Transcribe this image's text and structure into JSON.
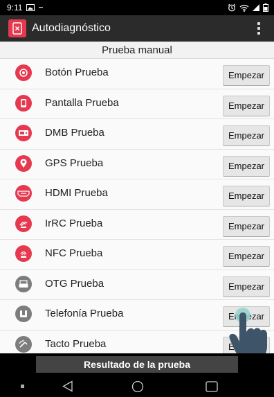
{
  "status_bar": {
    "time": "9:11"
  },
  "app_bar": {
    "title": "Autodiagnóstico"
  },
  "section": {
    "title": "Prueba manual"
  },
  "tests": [
    {
      "label": "Botón Prueba",
      "button": "Empezar",
      "icon": "button-icon"
    },
    {
      "label": "Pantalla Prueba",
      "button": "Empezar",
      "icon": "screen-icon"
    },
    {
      "label": "DMB Prueba",
      "button": "Empezar",
      "icon": "dmb-icon"
    },
    {
      "label": "GPS Prueba",
      "button": "Empezar",
      "icon": "gps-pin-icon"
    },
    {
      "label": "HDMI Prueba",
      "button": "Empezar",
      "icon": "hdmi-icon"
    },
    {
      "label": "IrRC Prueba",
      "button": "Empezar",
      "icon": "irrc-icon"
    },
    {
      "label": "NFC Prueba",
      "button": "Empezar",
      "icon": "nfc-icon"
    },
    {
      "label": "OTG Prueba",
      "button": "Empezar",
      "icon": "otg-icon"
    },
    {
      "label": "Telefonía Prueba",
      "button": "Empezar",
      "icon": "phone-icon"
    },
    {
      "label": "Tacto Prueba",
      "button": "Empezar",
      "icon": "touch-icon"
    }
  ],
  "result_button": "Resultado de la prueba",
  "colors": {
    "accent": "#e53950",
    "disabled_icon": "#7d7d7d",
    "app_bar": "#2b2b2b"
  }
}
